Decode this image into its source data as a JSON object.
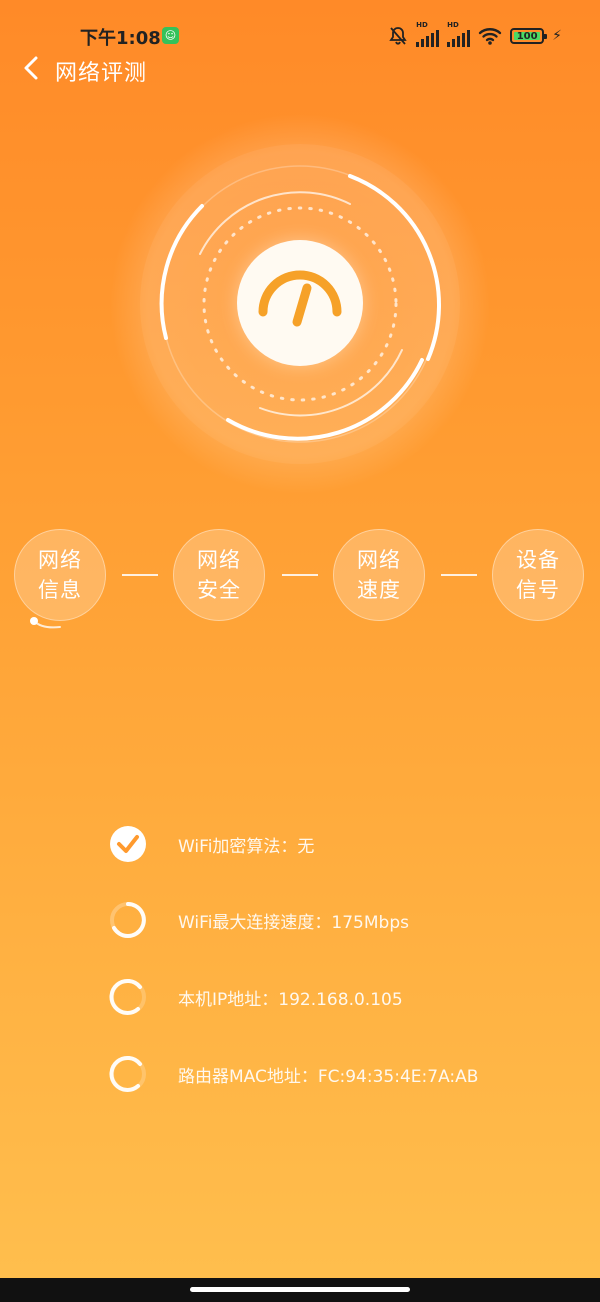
{
  "status_bar": {
    "time": "下午1:08",
    "app_badge": "☺",
    "signal1_label": "HD",
    "signal2_label": "HD",
    "battery": "100"
  },
  "header": {
    "title": "网络评测"
  },
  "steps": [
    {
      "label": "网络信息"
    },
    {
      "label": "网络安全"
    },
    {
      "label": "网络速度"
    },
    {
      "label": "设备信号"
    }
  ],
  "checks": [
    {
      "text": "WiFi加密算法：无",
      "state": "done"
    },
    {
      "text": "WiFi最大连接速度：175Mbps",
      "state": "loading"
    },
    {
      "text": "本机IP地址：192.168.0.105",
      "state": "loading"
    },
    {
      "text": "路由器MAC地址：FC:94:35:4E:7A:AB",
      "state": "loading"
    }
  ],
  "colors": {
    "accent": "#ff8a28",
    "gauge_needle": "#f6a128"
  }
}
